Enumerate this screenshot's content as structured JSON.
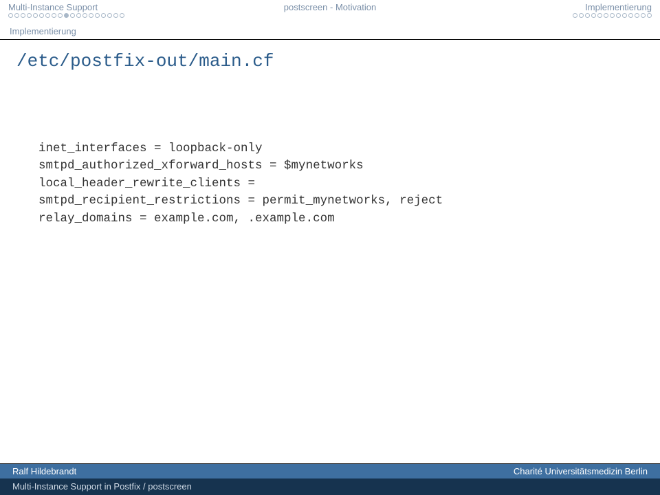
{
  "header": {
    "nav_left": "Multi-Instance Support",
    "nav_center": "postscreen - Motivation",
    "nav_right": "Implementierung",
    "sub_label": "Implementierung",
    "dots_left": {
      "total": 19,
      "filled_index": 9
    },
    "dots_right": {
      "total": 13
    }
  },
  "title": "/etc/postfix-out/main.cf",
  "code_lines": [
    "inet_interfaces = loopback-only",
    "smtpd_authorized_xforward_hosts = $mynetworks",
    "local_header_rewrite_clients =",
    "smtpd_recipient_restrictions = permit_mynetworks, reject",
    "relay_domains = example.com, .example.com"
  ],
  "footer": {
    "author": "Ralf Hildebrandt",
    "org": "Charité Universitätsmedizin Berlin",
    "talk_title": "Multi-Instance Support in Postfix / postscreen"
  }
}
